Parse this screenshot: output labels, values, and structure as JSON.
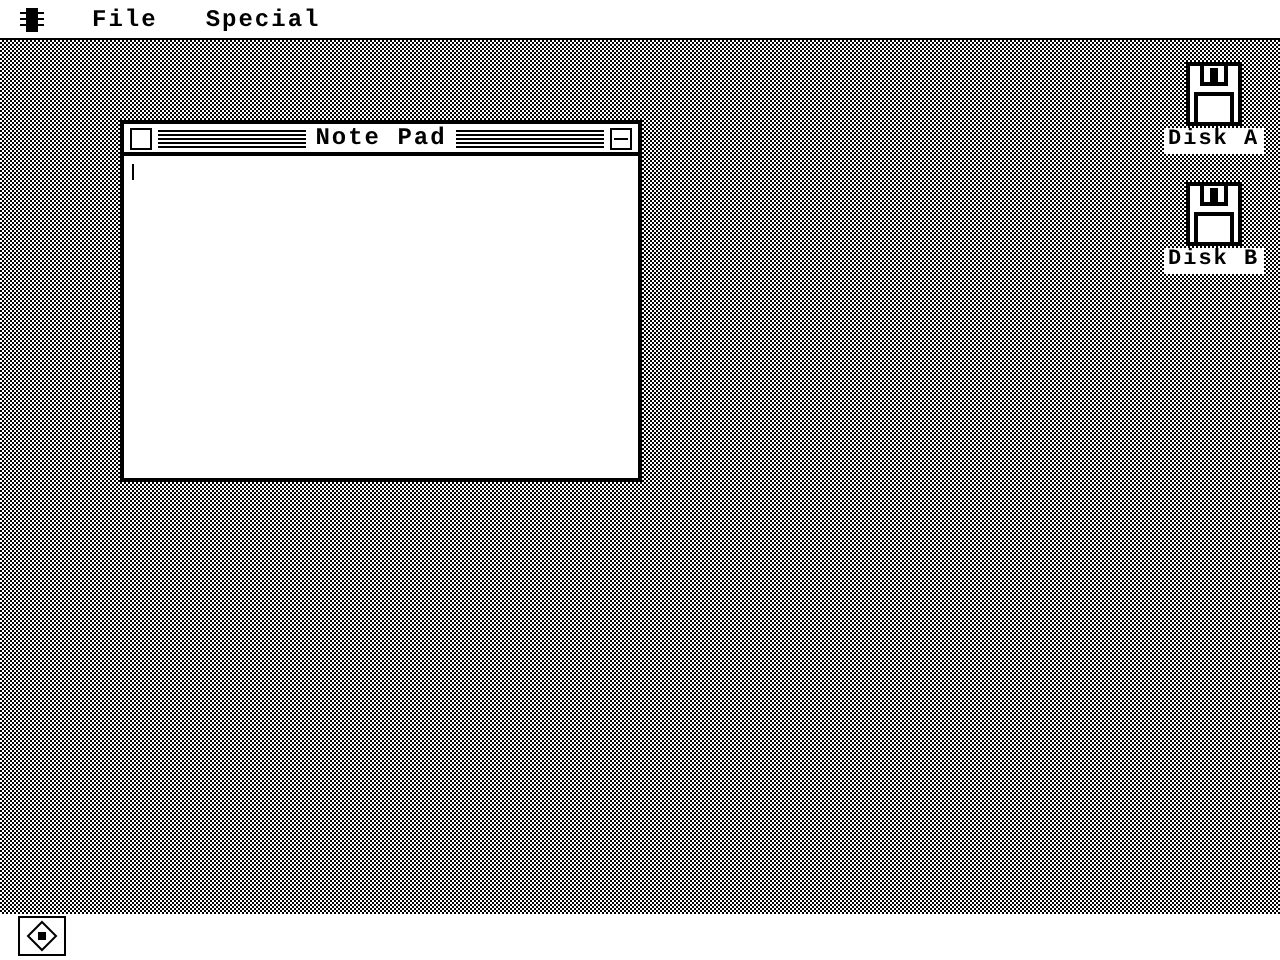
{
  "menu_bar": {
    "items": [
      {
        "label": "File"
      },
      {
        "label": "Special"
      }
    ]
  },
  "window": {
    "title": "Note Pad",
    "active": true
  },
  "desktop_icons": [
    {
      "label": "Disk A",
      "selected": false
    },
    {
      "label": "Disk B",
      "selected": false
    }
  ]
}
